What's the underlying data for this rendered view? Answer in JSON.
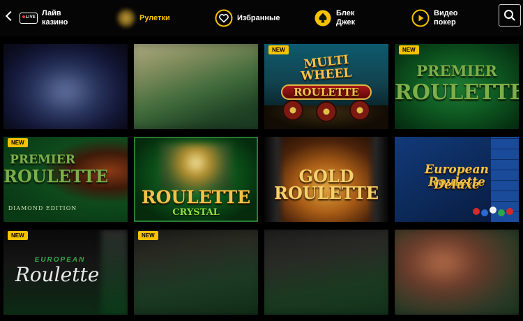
{
  "nav": {
    "back_icon": "chevron-left-icon",
    "items": [
      {
        "label": "Лайв казино",
        "icon": "live-badge-icon",
        "badge_text": "LIVE"
      },
      {
        "label": "Рулетки",
        "icon": "roulette-icon",
        "active": true
      },
      {
        "label": "Избранные",
        "icon": "heart-icon"
      },
      {
        "label": "Блек Джек",
        "icon": "spade-icon"
      },
      {
        "label": "Видео покер",
        "icon": "play-icon"
      }
    ],
    "search_icon": "search-icon",
    "accent_color": "#f6c200"
  },
  "new_label": "NEW",
  "games": [
    {
      "title": "",
      "blurred": true,
      "new": false
    },
    {
      "title": "",
      "blurred": true,
      "new": false
    },
    {
      "title": "MULTI WHEEL ROULETTE",
      "line1": "MULTI",
      "line2": "WHEEL",
      "line3": "ROULETTE",
      "blurred": false,
      "new": true
    },
    {
      "title": "PREMIER ROULETTE",
      "line1": "PREMIER",
      "line2": "ROULETTE",
      "blurred": false,
      "new": true
    },
    {
      "title": "PREMIER ROULETTE DIAMOND EDITION",
      "line1": "PREMIER",
      "line2": "ROULETTE",
      "line3": "DIAMOND EDITION",
      "blurred": false,
      "new": true
    },
    {
      "title": "ROULETTE CRYSTAL",
      "line1": "ROULETTE",
      "line2": "CRYSTAL",
      "blurred": false,
      "new": false
    },
    {
      "title": "GOLD ROULETTE",
      "line1": "GOLD",
      "line2": "ROULETTE",
      "blurred": false,
      "new": false
    },
    {
      "title": "European Roulette Deluxe",
      "line1": "European Roulette",
      "line2": "Deluxe",
      "blurred": false,
      "new": false
    },
    {
      "title": "EUROPEAN Roulette",
      "line1": "EUROPEAN",
      "line2": "Roulette",
      "blurred": false,
      "new": true
    },
    {
      "title": "",
      "blurred": true,
      "new": true
    },
    {
      "title": "",
      "blurred": true,
      "new": false
    },
    {
      "title": "",
      "blurred": true,
      "new": false
    }
  ]
}
